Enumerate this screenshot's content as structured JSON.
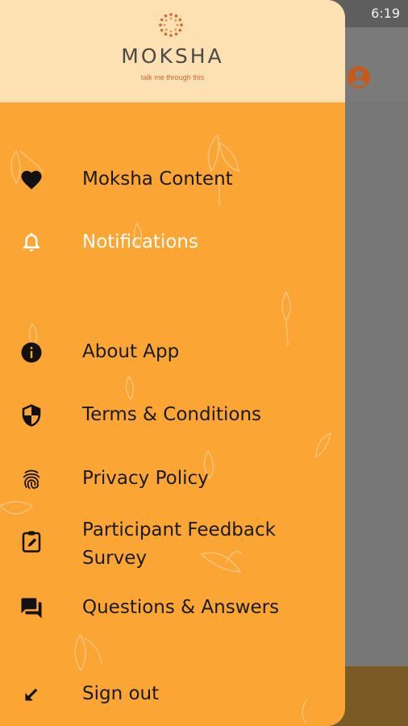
{
  "status_bar": {
    "time": "6:19"
  },
  "drawer": {
    "brand": "MOKSHA",
    "tagline": "talk me through this",
    "menu": [
      {
        "label": "Moksha Content",
        "icon": "heart-icon"
      },
      {
        "label": "Notifications",
        "icon": "bell-icon",
        "active": true
      },
      {
        "label": "About App",
        "icon": "info-icon"
      },
      {
        "label": "Terms & Conditions",
        "icon": "shield-icon"
      },
      {
        "label": "Privacy Policy",
        "icon": "fingerprint-icon"
      },
      {
        "label": "Participant Feedback Survey",
        "line1": "Participant Feedback",
        "line2": "Survey",
        "icon": "clipboard-edit-icon"
      },
      {
        "label": "Questions & Answers",
        "icon": "forum-icon"
      },
      {
        "label": "Sign out",
        "icon": "arrow-down-left-icon"
      }
    ]
  },
  "colors": {
    "drawer_bg": "#fba634",
    "header_bg": "#fde1b3",
    "accent": "#d1662e",
    "active_text": "#ffffff"
  }
}
